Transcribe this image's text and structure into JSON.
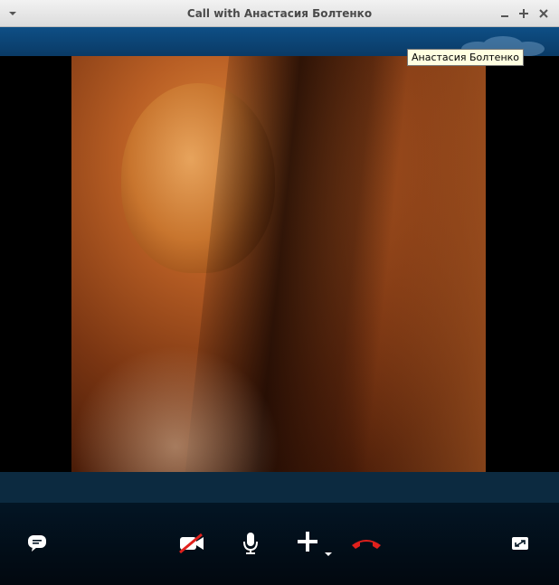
{
  "window": {
    "title": "Call with Анастасия Болтенко"
  },
  "tooltip": {
    "text": "Анастасия Болтенко"
  },
  "controls": {
    "chat": "chat-icon",
    "video": "video-off-icon",
    "mic": "microphone-icon",
    "add": "add-icon",
    "hangup": "end-call-icon",
    "fullscreen": "fullscreen-icon"
  },
  "colors": {
    "hangup": "#e0201c",
    "controls_bg": "#031524",
    "titlebar": "#e6e6e6"
  }
}
